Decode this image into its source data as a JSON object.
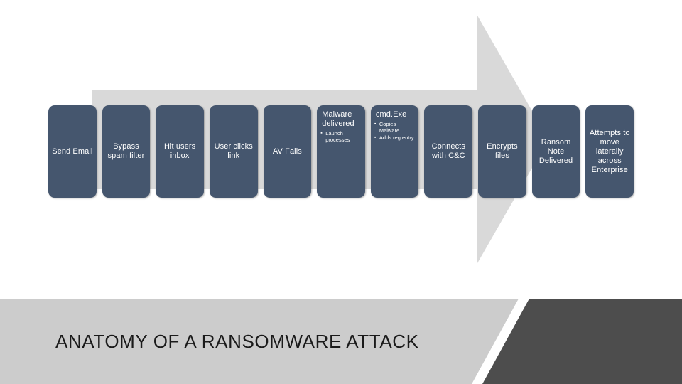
{
  "slide": {
    "title": "ANATOMY OF A RANSOMWARE ATTACK",
    "colors": {
      "box_fill": "#45566e",
      "box_text": "#ffffff",
      "arrow_fill": "#d9d9d9",
      "band_light": "#cccccc",
      "band_dark": "#4d4d4d",
      "background": "#ffffff",
      "title_text": "#1a1a1a"
    }
  },
  "arrow": {
    "name": "right-pointing-process-arrow",
    "direction": "right"
  },
  "process": {
    "steps": [
      {
        "title": "Send Email",
        "bullets": []
      },
      {
        "title": "Bypass spam filter",
        "bullets": []
      },
      {
        "title": "Hit users inbox",
        "bullets": []
      },
      {
        "title": "User clicks link",
        "bullets": []
      },
      {
        "title": "AV Fails",
        "bullets": []
      },
      {
        "title": "Malware delivered",
        "bullets": [
          "Launch processes"
        ]
      },
      {
        "title": "cmd.Exe",
        "bullets": [
          "Copies Malware",
          "Adds reg entry"
        ]
      },
      {
        "title": "Connects with C&C",
        "bullets": []
      },
      {
        "title": "Encrypts files",
        "bullets": []
      },
      {
        "title": "Ransom Note Delivered",
        "bullets": []
      },
      {
        "title": "Attempts to move laterally across Enterprise",
        "bullets": []
      }
    ]
  }
}
